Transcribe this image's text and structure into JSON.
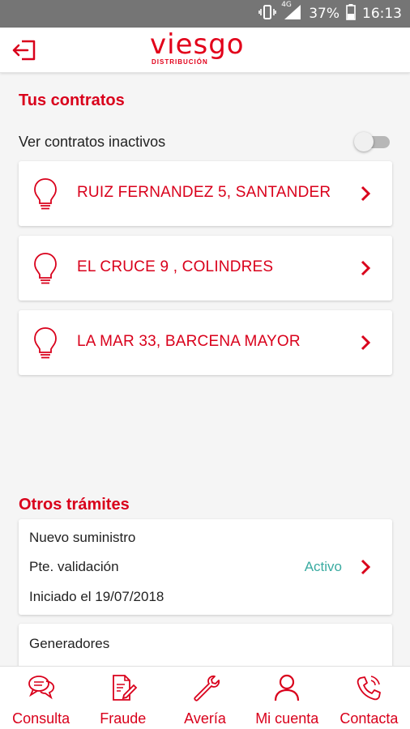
{
  "status_bar": {
    "network": "4G",
    "battery": "37%",
    "time": "16:13"
  },
  "header": {
    "logo_text": "viesgo",
    "logo_subtitle": "DISTRIBUCIÓN",
    "logout_icon": "logout-icon"
  },
  "contracts_section": {
    "title": "Tus contratos",
    "inactive_toggle_label": "Ver contratos inactivos",
    "inactive_toggle_on": false,
    "items": [
      {
        "address": "RUIZ FERNANDEZ 5, SANTANDER",
        "icon": "lightbulb-icon"
      },
      {
        "address": "EL CRUCE 9 , COLINDRES",
        "icon": "lightbulb-icon"
      },
      {
        "address": "LA MAR 33, BARCENA MAYOR",
        "icon": "lightbulb-icon"
      }
    ]
  },
  "other_section": {
    "title": "Otros trámites",
    "items": [
      {
        "type": "Nuevo suministro",
        "state": "Pte. validación",
        "status": "Activo",
        "started": "Iniciado el 19/07/2018"
      },
      {
        "type": "Generadores"
      }
    ]
  },
  "bottom_nav": [
    {
      "label": "Consulta",
      "icon": "chat-bubbles-icon"
    },
    {
      "label": "Fraude",
      "icon": "document-pen-icon"
    },
    {
      "label": "Avería",
      "icon": "wrench-icon"
    },
    {
      "label": "Mi cuenta",
      "icon": "user-icon"
    },
    {
      "label": "Contacta",
      "icon": "phone-icon"
    }
  ],
  "colors": {
    "brand_red": "#d9001b",
    "status_green": "#3aaba1",
    "statusbar": "#757575"
  }
}
